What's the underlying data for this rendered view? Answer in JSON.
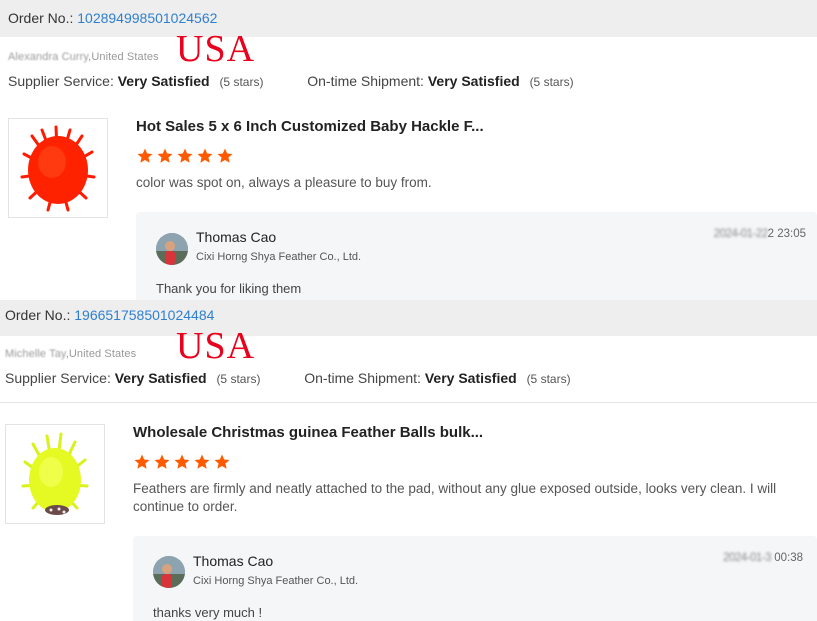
{
  "colors": {
    "accent_link": "#2f7fd0",
    "star": "#ff5a00",
    "stamp": "#e8001c",
    "order_bar": "#eeeeee",
    "reply_bg": "#f5f6f7"
  },
  "icons": {
    "star": "star-icon",
    "avatar": "seller-avatar"
  },
  "labels": {
    "order_no": "Order No.:",
    "supplier_service": "Supplier Service:",
    "ontime_shipment": "On-time Shipment:"
  },
  "reviews": [
    {
      "order_number": "102894998501024562",
      "buyer_name": "Alexandra Curry",
      "buyer_country": ",United States",
      "stamp": "USA",
      "supplier_service_value": "Very Satisfied",
      "supplier_service_stars": "(5 stars)",
      "ontime_shipment_value": "Very Satisfied",
      "ontime_shipment_stars": "(5 stars)",
      "product_title": "Hot Sales 5 x 6 Inch Customized Baby Hackle F...",
      "rating": 5,
      "review_text": "color was spot on, always a pleasure to buy from.",
      "reply": {
        "name": "Thomas Cao",
        "company": "Cixi Horng Shya Feather Co., Ltd.",
        "date_hidden": "2024-01-22",
        "time": "2 23:05",
        "text": "Thank you for liking them"
      }
    },
    {
      "order_number": "196651758501024484",
      "buyer_name": "Michelle Tay",
      "buyer_country": ",United States",
      "stamp": "USA",
      "supplier_service_value": "Very Satisfied",
      "supplier_service_stars": "(5 stars)",
      "ontime_shipment_value": "Very Satisfied",
      "ontime_shipment_stars": "(5 stars)",
      "product_title": "Wholesale Christmas guinea Feather Balls bulk...",
      "rating": 5,
      "review_text": "Feathers are firmly and neatly attached to the pad, without any glue exposed outside, looks very clean. I will continue to order.",
      "reply": {
        "name": "Thomas Cao",
        "company": "Cixi Horng Shya Feather Co., Ltd.",
        "date_hidden": "2024-01-3",
        "time": "00:38",
        "text": "thanks very much !"
      }
    }
  ]
}
